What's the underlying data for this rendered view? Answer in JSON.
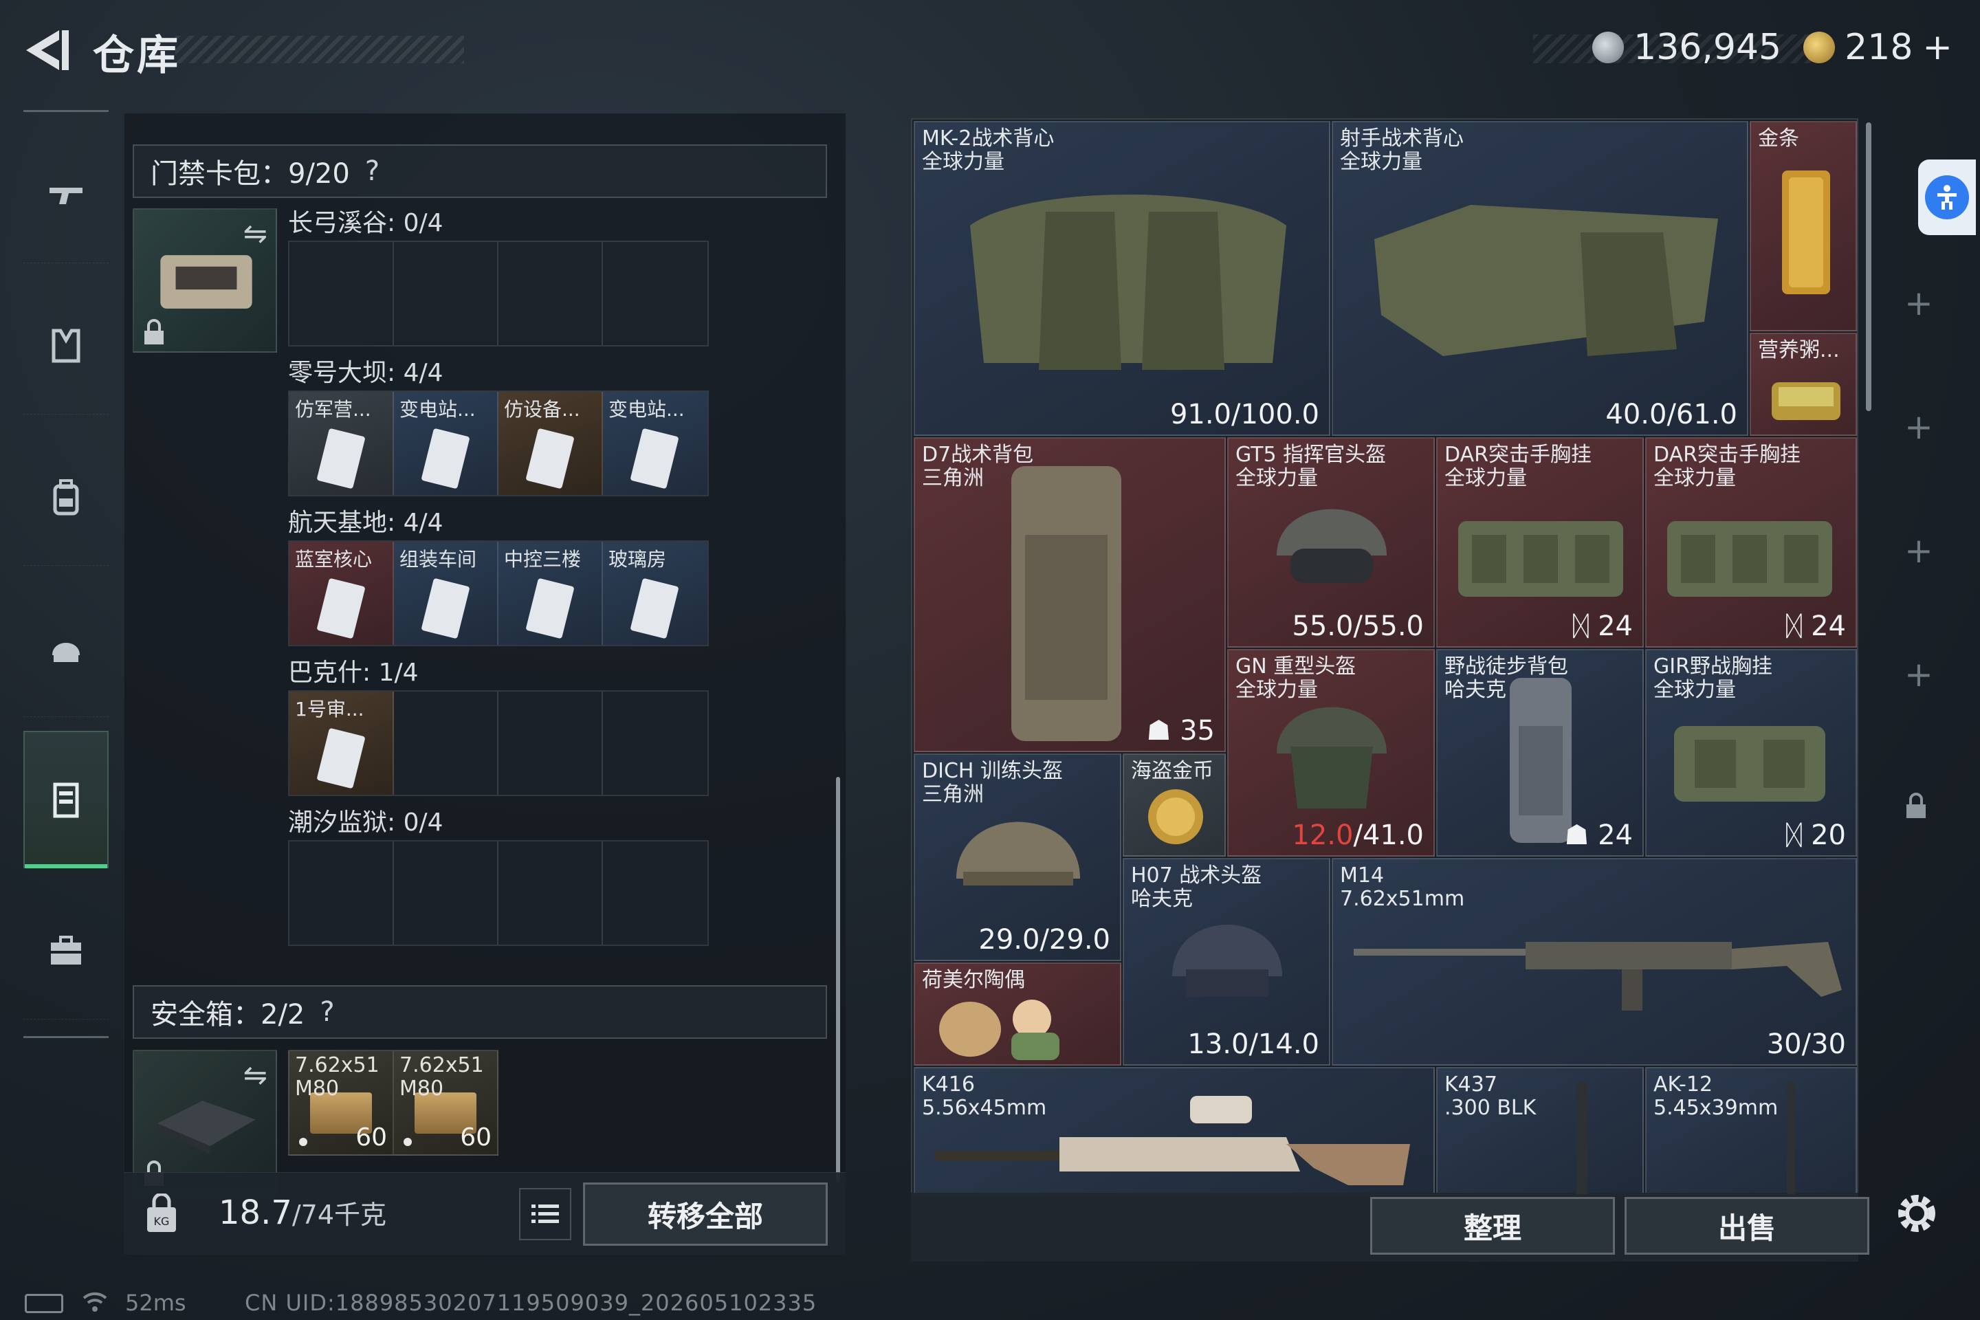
{
  "header": {
    "title": "仓库",
    "currency_silver": "136,945",
    "currency_gold": "218",
    "currency_gold_plus": "+"
  },
  "nav": {
    "items": [
      {
        "name": "weapons",
        "icon": "gun-icon"
      },
      {
        "name": "armor",
        "icon": "vest-icon"
      },
      {
        "name": "backpack",
        "icon": "backpack-icon"
      },
      {
        "name": "helmet",
        "icon": "helmet-icon"
      },
      {
        "name": "storage",
        "icon": "locker-icon",
        "active": true
      },
      {
        "name": "briefcase",
        "icon": "briefcase-icon"
      }
    ]
  },
  "keycard_case": {
    "title": "门禁卡包：9/20",
    "help": "?",
    "maps": [
      {
        "label": "长弓溪谷: 0/4",
        "slots": []
      },
      {
        "label": "零号大坝: 4/4",
        "slots": [
          {
            "label": "仿军营...",
            "bg": "grey"
          },
          {
            "label": "变电站...",
            "bg": "blue"
          },
          {
            "label": "仿设备...",
            "bg": "brown"
          },
          {
            "label": "变电站...",
            "bg": "blue"
          }
        ]
      },
      {
        "label": "航天基地: 4/4",
        "slots": [
          {
            "label": "蓝室核心",
            "bg": "red"
          },
          {
            "label": "组装车间",
            "bg": "blue"
          },
          {
            "label": "中控三楼",
            "bg": "blue"
          },
          {
            "label": "玻璃房",
            "bg": "blue"
          }
        ]
      },
      {
        "label": "巴克什: 1/4",
        "slots": [
          {
            "label": "1号审...",
            "bg": "brown"
          }
        ]
      },
      {
        "label": "潮汐监狱: 0/4",
        "slots": []
      }
    ]
  },
  "safe_box": {
    "title": "安全箱：2/2",
    "help": "?",
    "ammo": [
      {
        "line1": "7.62x51",
        "line2": "M80",
        "count": "60"
      },
      {
        "line1": "7.62x51",
        "line2": "M80",
        "count": "60"
      }
    ]
  },
  "left_footer": {
    "weight": "18.7",
    "weight_max": "/74千克",
    "transfer_all": "转移全部"
  },
  "stash_items": [
    {
      "id": "mk2",
      "name": "MK-2战术背心",
      "sub": "全球力量",
      "stat": "91.0/100.0",
      "bg": "bg-navy"
    },
    {
      "id": "marksman",
      "name": "射手战术背心",
      "sub": "全球力量",
      "stat": "40.0/61.0",
      "bg": "bg-navy"
    },
    {
      "id": "goldbar",
      "name": "金条",
      "sub": "",
      "stat": "",
      "bg": "bg-red"
    },
    {
      "id": "tin",
      "name": "营养粥...",
      "sub": "",
      "stat": "",
      "bg": "bg-red"
    },
    {
      "id": "d7",
      "name": "D7战术背包",
      "sub": "三角洲",
      "stat": "35",
      "bg": "bg-red"
    },
    {
      "id": "gt5",
      "name": "GT5 指挥官头盔",
      "sub": "全球力量",
      "stat": "55.0/55.0",
      "bg": "bg-red"
    },
    {
      "id": "dar1",
      "name": "DAR突击手胸挂",
      "sub": "全球力量",
      "stat": "24",
      "bg": "bg-red"
    },
    {
      "id": "dar2",
      "name": "DAR突击手胸挂",
      "sub": "全球力量",
      "stat": "24",
      "bg": "bg-red"
    },
    {
      "id": "gn",
      "name": "GN 重型头盔",
      "sub": "全球力量",
      "stat_red": "12.0",
      "stat": "/41.0",
      "bg": "bg-red"
    },
    {
      "id": "hiker",
      "name": "野战徒步背包",
      "sub": "哈夫克",
      "stat": "24",
      "bg": "bg-navy"
    },
    {
      "id": "gir",
      "name": "GIR野战胸挂",
      "sub": "全球力量",
      "stat": "20",
      "bg": "bg-navy"
    },
    {
      "id": "dich",
      "name": "DICH 训练头盔",
      "sub": "三角洲",
      "stat": "29.0/29.0",
      "bg": "bg-navy"
    },
    {
      "id": "coin",
      "name": "海盗金币",
      "sub": "",
      "stat": "",
      "bg": "bg-grey"
    },
    {
      "id": "h07",
      "name": "H07 战术头盔",
      "sub": "哈夫克",
      "stat": "13.0/14.0",
      "bg": "bg-navy"
    },
    {
      "id": "m14",
      "name": "M14",
      "sub": "7.62x51mm",
      "stat": "30/30",
      "bg": "bg-navy"
    },
    {
      "id": "figurine",
      "name": "荷美尔陶偶",
      "sub": "",
      "stat": "",
      "bg": "bg-red"
    },
    {
      "id": "k416",
      "name": "K416",
      "sub": "5.56x45mm",
      "stat": "",
      "bg": "bg-navy"
    },
    {
      "id": "k437",
      "name": "K437",
      "sub": ".300 BLK",
      "stat": "",
      "bg": "bg-navy"
    },
    {
      "id": "ak12",
      "name": "AK-12",
      "sub": "5.45x39mm",
      "stat": "",
      "bg": "bg-navy"
    }
  ],
  "right_footer": {
    "sort": "整理",
    "sell": "出售"
  },
  "status": {
    "ping": "52ms",
    "uid": "CN UID:18898530207119509039_202605102335"
  }
}
